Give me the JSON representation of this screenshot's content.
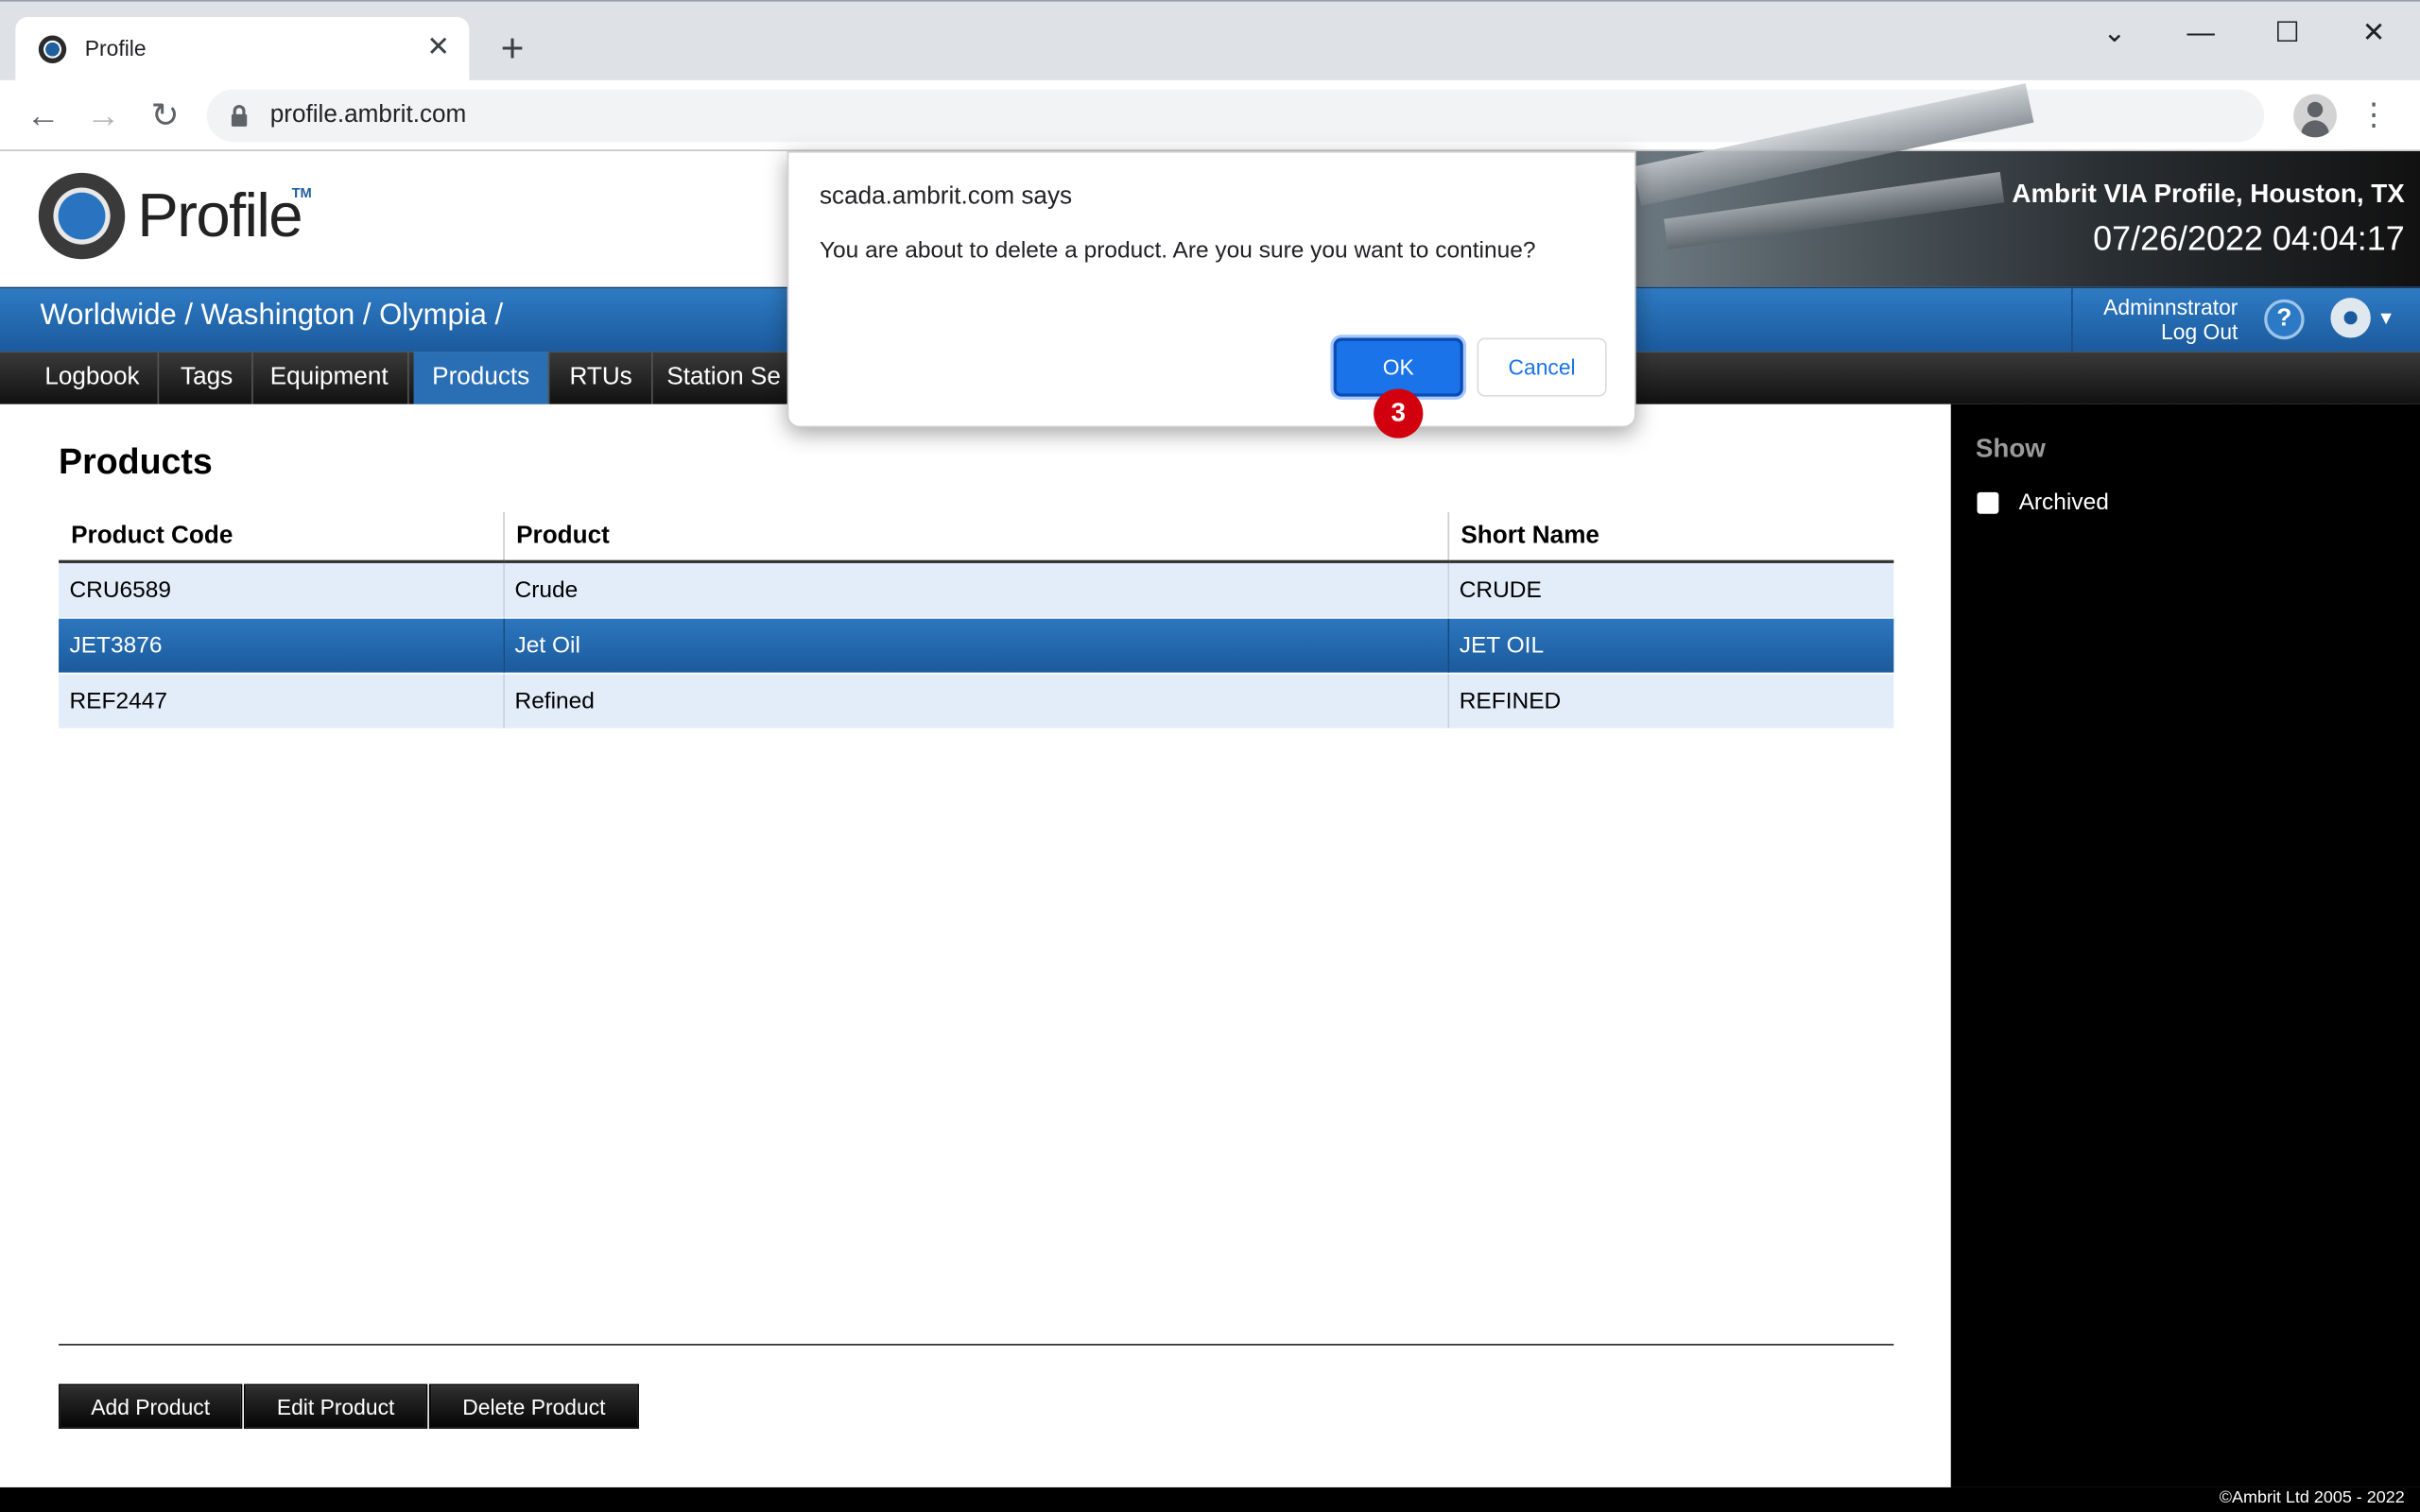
{
  "browser": {
    "tab_title": "Profile",
    "url": "profile.ambrit.com",
    "new_tab_glyph": "+",
    "close_glyph": "✕"
  },
  "header": {
    "logo_text": "Profile",
    "logo_tm": "TM",
    "site_name": "Ambrit VIA Profile, Houston, TX",
    "clock": "07/26/2022 04:04:17"
  },
  "breadcrumb": "Worldwide / Washington / Olympia /",
  "user": {
    "name": "Adminnstrator",
    "logout": "Log Out"
  },
  "help_glyph": "?",
  "nav": {
    "items": [
      {
        "label": "Logbook"
      },
      {
        "label": "Tags"
      },
      {
        "label": "Equipment"
      },
      {
        "label": "Products"
      },
      {
        "label": "RTUs"
      },
      {
        "label": "Station Se"
      }
    ],
    "active": "Products"
  },
  "main": {
    "title": "Products",
    "columns": [
      "Product Code",
      "Product",
      "Short Name"
    ],
    "rows": [
      {
        "code": "CRU6589",
        "product": "Crude",
        "short": "CRUDE"
      },
      {
        "code": "JET3876",
        "product": "Jet Oil",
        "short": "JET OIL"
      },
      {
        "code": "REF2447",
        "product": "Refined",
        "short": "REFINED"
      }
    ],
    "selected_row": "JET3876",
    "buttons": {
      "add": "Add Product",
      "edit": "Edit Product",
      "delete": "Delete Product"
    }
  },
  "sidepanel": {
    "title": "Show",
    "archived_label": "Archived",
    "archived_checked": false
  },
  "footer": "©Ambrit Ltd 2005 - 2022",
  "dialog": {
    "title": "scada.ambrit.com says",
    "message": "You are about to delete a product. Are you sure you want to continue?",
    "ok_label": "OK",
    "cancel_label": "Cancel",
    "step_badge": "3"
  },
  "icons": {
    "back": "back-arrow-icon",
    "forward": "forward-arrow-icon",
    "reload": "reload-icon",
    "lock": "lock-icon",
    "profile": "account-icon",
    "menu": "kebab-menu-icon",
    "help": "help-icon",
    "gear": "gear-icon"
  },
  "colors": {
    "accent_blue": "#1b5a9c",
    "row_bg": "#e3edf9",
    "dialog_ok": "#1a73e8",
    "badge_red": "#d2000f"
  }
}
